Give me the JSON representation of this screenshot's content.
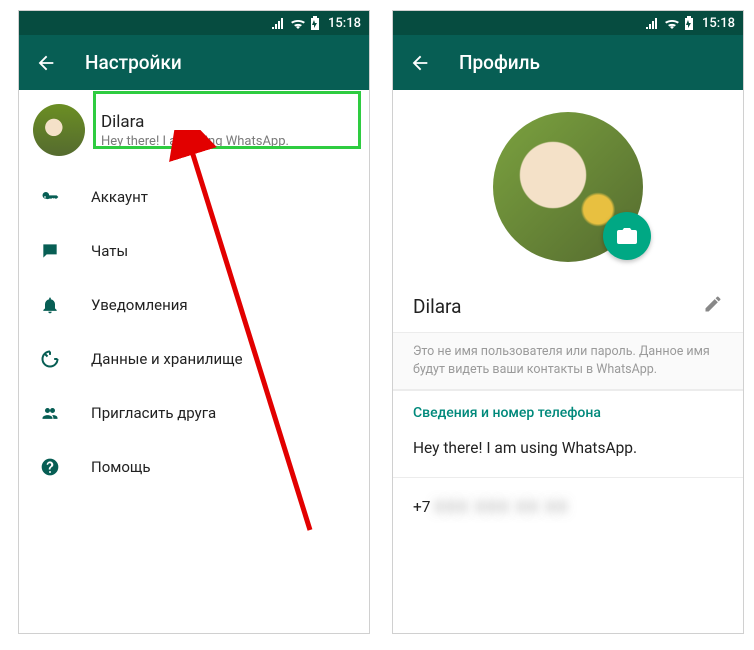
{
  "statusbar": {
    "time": "15:18"
  },
  "settings": {
    "title": "Настройки",
    "profile": {
      "name": "Dilara",
      "status": "Hey there! I am using WhatsApp."
    },
    "items": [
      {
        "icon": "key-icon",
        "label": "Аккаунт"
      },
      {
        "icon": "chat-icon",
        "label": "Чаты"
      },
      {
        "icon": "bell-icon",
        "label": "Уведомления"
      },
      {
        "icon": "data-icon",
        "label": "Данные и хранилище"
      },
      {
        "icon": "invite-icon",
        "label": "Пригласить друга"
      },
      {
        "icon": "help-icon",
        "label": "Помощь"
      }
    ]
  },
  "profile": {
    "title": "Профиль",
    "name": "Dilara",
    "hint": "Это не имя пользователя или пароль. Данное имя будут видеть ваши контакты в WhatsApp.",
    "info_section_title": "Сведения и номер телефона",
    "about": "Hey there! I am using WhatsApp.",
    "phone": "+7",
    "phone_rest": "XXX XXX XX XX"
  }
}
